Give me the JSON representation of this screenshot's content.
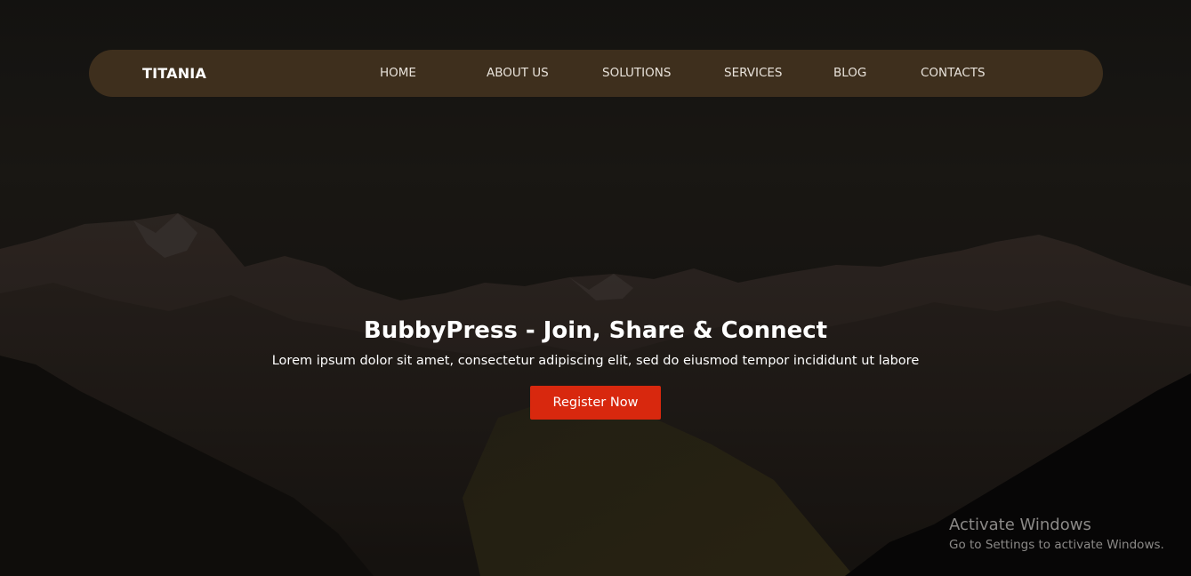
{
  "brand": {
    "name": "TITANIA"
  },
  "nav": {
    "items": [
      {
        "label": "HOME"
      },
      {
        "label": "ABOUT US"
      },
      {
        "label": "SOLUTIONS"
      },
      {
        "label": "SERVICES"
      },
      {
        "label": "BLOG"
      },
      {
        "label": "CONTACTS"
      }
    ]
  },
  "hero": {
    "title": "BubbyPress - Join, Share & Connect",
    "subtitle": "Lorem ipsum dolor sit amet, consectetur adipiscing elit, sed do eiusmod tempor incididunt ut labore",
    "cta_label": "Register Now"
  },
  "os_watermark": {
    "title": "Activate Windows",
    "subtitle": "Go to Settings to activate Windows."
  },
  "colors": {
    "navbar_bg": "#3e2f1d",
    "cta_bg": "#d8280e",
    "text": "#ffffff"
  }
}
